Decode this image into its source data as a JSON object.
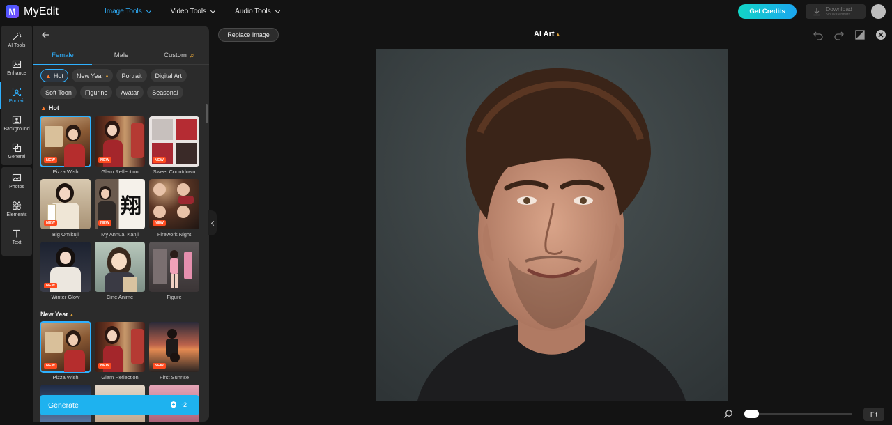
{
  "app": {
    "name": "MyEdit",
    "logo_letter": "M"
  },
  "nav": {
    "items": [
      {
        "label": "Image Tools",
        "active": true
      },
      {
        "label": "Video Tools",
        "active": false
      },
      {
        "label": "Audio Tools",
        "active": false
      }
    ],
    "get_credits": "Get Credits",
    "download": {
      "label": "Download",
      "sub": "No Watermark"
    }
  },
  "rail": {
    "items": [
      {
        "label": "AI Tools",
        "icon": "magic-wand-icon"
      },
      {
        "label": "Enhance",
        "icon": "enhance-icon"
      },
      {
        "label": "Portrait",
        "icon": "portrait-icon",
        "active": true
      },
      {
        "label": "Background",
        "icon": "background-icon"
      },
      {
        "label": "General",
        "icon": "general-icon"
      },
      {
        "label": "Photos",
        "icon": "photos-icon"
      },
      {
        "label": "Elements",
        "icon": "elements-icon"
      },
      {
        "label": "Text",
        "icon": "text-icon"
      }
    ]
  },
  "panel": {
    "tabs": [
      {
        "label": "Female",
        "active": true
      },
      {
        "label": "Male",
        "active": false
      },
      {
        "label": "Custom",
        "active": false
      }
    ],
    "chips_row1": [
      "Hot",
      "New Year",
      "Portrait",
      "Digital Art"
    ],
    "chips_row2": [
      "Soft Toon",
      "Figurine",
      "Avatar",
      "Seasonal"
    ],
    "sections": [
      {
        "title": "Hot",
        "cards": [
          {
            "label": "Pizza Wish",
            "badge": "NEW",
            "selected": true
          },
          {
            "label": "Glam Reflection",
            "badge": "NEW"
          },
          {
            "label": "Sweet Countdown",
            "badge": "NEW"
          },
          {
            "label": "Big Omikuji",
            "badge": "NEW"
          },
          {
            "label": "My Annual Kanji",
            "badge": "NEW",
            "kanji": "翔"
          },
          {
            "label": "Firework Night",
            "badge": "NEW"
          },
          {
            "label": "Winter Glow",
            "badge": "NEW"
          },
          {
            "label": "Cine Anime",
            "badge": ""
          },
          {
            "label": "Figure",
            "badge": ""
          }
        ]
      },
      {
        "title": "New Year",
        "cards": [
          {
            "label": "Pizza Wish",
            "badge": "NEW",
            "selected": true
          },
          {
            "label": "Glam Reflection",
            "badge": "NEW"
          },
          {
            "label": "First Sunrise",
            "badge": "NEW"
          }
        ]
      }
    ],
    "generate": {
      "label": "Generate",
      "cost": "-2"
    }
  },
  "canvas": {
    "replace_button": "Replace Image",
    "title": "AI Art",
    "fit_button": "Fit",
    "zoom_level": 0
  },
  "colors": {
    "accent": "#2fb1ff",
    "generate": "#1eb2ef",
    "badge": "#ff4b1f",
    "credits_gradient_start": "#12d5c6"
  }
}
